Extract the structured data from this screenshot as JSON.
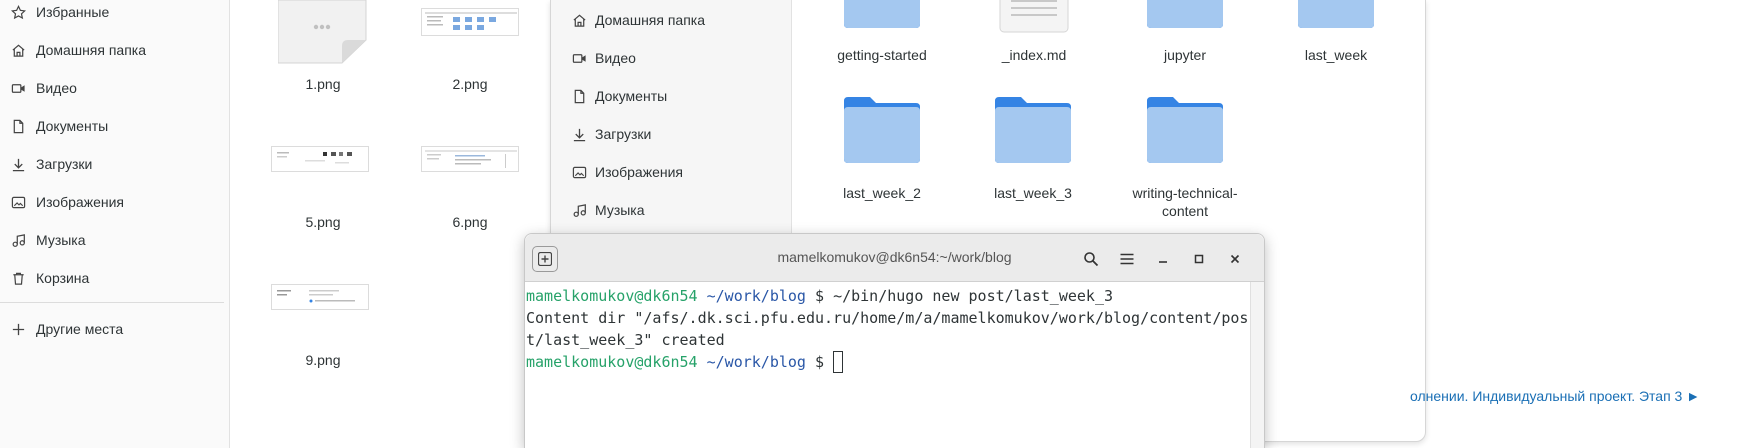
{
  "sidebar": {
    "items": [
      {
        "label": "Избранные",
        "icon": "star-icon"
      },
      {
        "label": "Домашняя папка",
        "icon": "home-icon"
      },
      {
        "label": "Видео",
        "icon": "video-icon"
      },
      {
        "label": "Документы",
        "icon": "document-icon"
      },
      {
        "label": "Загрузки",
        "icon": "download-icon"
      },
      {
        "label": "Изображения",
        "icon": "image-icon"
      },
      {
        "label": "Музыка",
        "icon": "music-icon"
      },
      {
        "label": "Корзина",
        "icon": "trash-icon"
      }
    ],
    "other_places": "Другие места"
  },
  "files": [
    {
      "name": "1.png"
    },
    {
      "name": "2.png"
    },
    {
      "name": "5.png"
    },
    {
      "name": "6.png"
    },
    {
      "name": "9.png"
    }
  ],
  "fm2": {
    "sidebar": [
      {
        "label": "Домашняя папка",
        "icon": "home-icon"
      },
      {
        "label": "Видео",
        "icon": "video-icon"
      },
      {
        "label": "Документы",
        "icon": "document-icon"
      },
      {
        "label": "Загрузки",
        "icon": "download-icon"
      },
      {
        "label": "Изображения",
        "icon": "image-icon"
      },
      {
        "label": "Музыка",
        "icon": "music-icon"
      }
    ],
    "folders": [
      {
        "name": "getting-started"
      },
      {
        "name": "_index.md"
      },
      {
        "name": "jupyter"
      },
      {
        "name": "last_week"
      },
      {
        "name": "last_week_2"
      },
      {
        "name": "last_week_3"
      },
      {
        "name": "writing-technical-content"
      }
    ]
  },
  "background_link": "олнении. Индивидуальный проект. Этап 3 ►",
  "terminal": {
    "title": "mamelkomukov@dk6n54:~/work/blog",
    "prompt_user": "mamelkomukov@dk6n54",
    "prompt_dir": "~/work/blog",
    "prompt_symbol": "$",
    "command": "~/bin/hugo new post/last_week_3",
    "output_line1": "Content dir \"/afs/.dk.sci.pfu.edu.ru/home/m/a/mamelkomukov/work/blog/content/pos",
    "output_line2": "t/last_week_3\" created"
  },
  "colors": {
    "folder_top": "#3584e4",
    "folder_body": "#a4c8f0",
    "prompt_user": "#26a269",
    "prompt_dir": "#2a57a7",
    "link": "#1a6fb5"
  }
}
